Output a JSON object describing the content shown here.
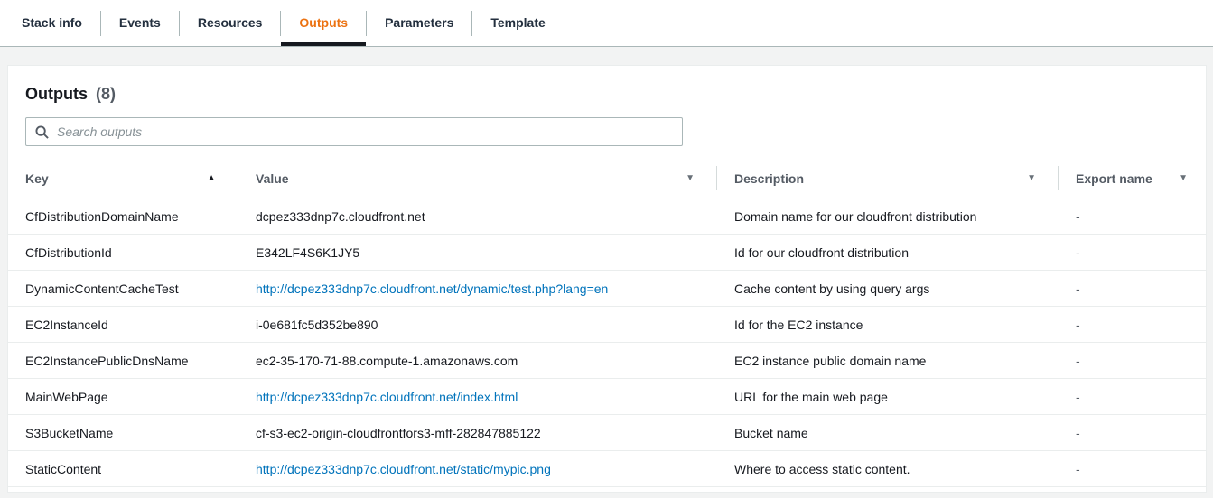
{
  "tabs": {
    "items": [
      {
        "label": "Stack info",
        "active": false
      },
      {
        "label": "Events",
        "active": false
      },
      {
        "label": "Resources",
        "active": false
      },
      {
        "label": "Outputs",
        "active": true
      },
      {
        "label": "Parameters",
        "active": false
      },
      {
        "label": "Template",
        "active": false
      }
    ]
  },
  "panel": {
    "title": "Outputs",
    "count": "(8)",
    "search": {
      "placeholder": "Search outputs",
      "value": "",
      "icon": "search-icon"
    }
  },
  "table": {
    "columns": [
      {
        "label": "Key",
        "sort": "ascending",
        "sort_icon": "▲"
      },
      {
        "label": "Value",
        "filter_icon": "▼"
      },
      {
        "label": "Description",
        "filter_icon": "▼"
      },
      {
        "label": "Export name",
        "filter_icon": "▼"
      }
    ],
    "rows": [
      {
        "key": "CfDistributionDomainName",
        "value": "dcpez333dnp7c.cloudfront.net",
        "value_is_link": false,
        "description": "Domain name for our cloudfront distribution",
        "export_name": "-"
      },
      {
        "key": "CfDistributionId",
        "value": "E342LF4S6K1JY5",
        "value_is_link": false,
        "description": "Id for our cloudfront distribution",
        "export_name": "-"
      },
      {
        "key": "DynamicContentCacheTest",
        "value": "http://dcpez333dnp7c.cloudfront.net/dynamic/test.php?lang=en",
        "value_is_link": true,
        "description": "Cache content by using query args",
        "export_name": "-"
      },
      {
        "key": "EC2InstanceId",
        "value": "i-0e681fc5d352be890",
        "value_is_link": false,
        "description": "Id for the EC2 instance",
        "export_name": "-"
      },
      {
        "key": "EC2InstancePublicDnsName",
        "value": "ec2-35-170-71-88.compute-1.amazonaws.com",
        "value_is_link": false,
        "description": "EC2 instance public domain name",
        "export_name": "-"
      },
      {
        "key": "MainWebPage",
        "value": "http://dcpez333dnp7c.cloudfront.net/index.html",
        "value_is_link": true,
        "description": "URL for the main web page",
        "export_name": "-"
      },
      {
        "key": "S3BucketName",
        "value": "cf-s3-ec2-origin-cloudfrontfors3-mff-282847885122",
        "value_is_link": false,
        "description": "Bucket name",
        "export_name": "-"
      },
      {
        "key": "StaticContent",
        "value": "http://dcpez333dnp7c.cloudfront.net/static/mypic.png",
        "value_is_link": true,
        "description": "Where to access static content.",
        "export_name": "-"
      }
    ]
  },
  "colors": {
    "accent_tab": "#ec7211",
    "tab_underline": "#16191f",
    "link": "#0073bb",
    "text": "#16191f",
    "muted": "#545b64",
    "border": "#eaeded",
    "panel_bg": "#ffffff",
    "page_bg": "#f2f3f3"
  }
}
